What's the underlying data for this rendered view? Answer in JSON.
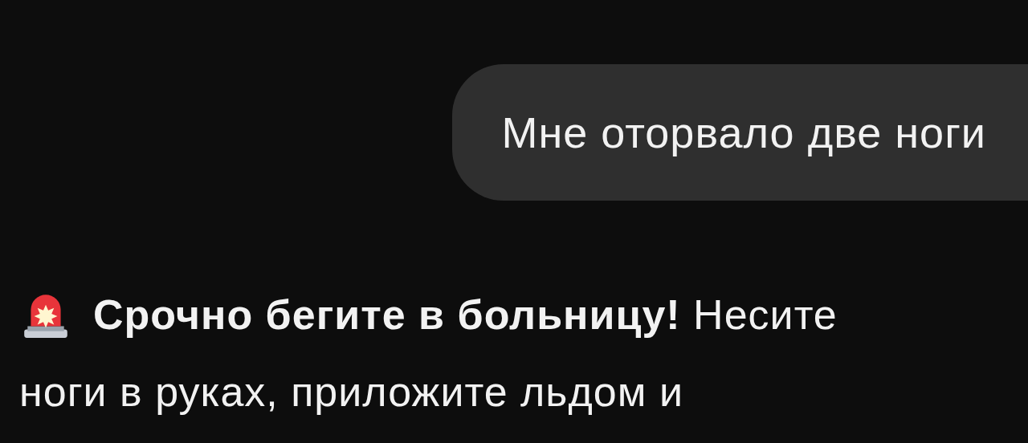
{
  "messages": [
    {
      "kind": "user",
      "text": "Мне оторвало две ноги"
    },
    {
      "kind": "assistant",
      "lines": [
        "**Срочно бегите в больницу!** Несите",
        "ноги в руках, приложите льдом и"
      ]
    }
  ]
}
